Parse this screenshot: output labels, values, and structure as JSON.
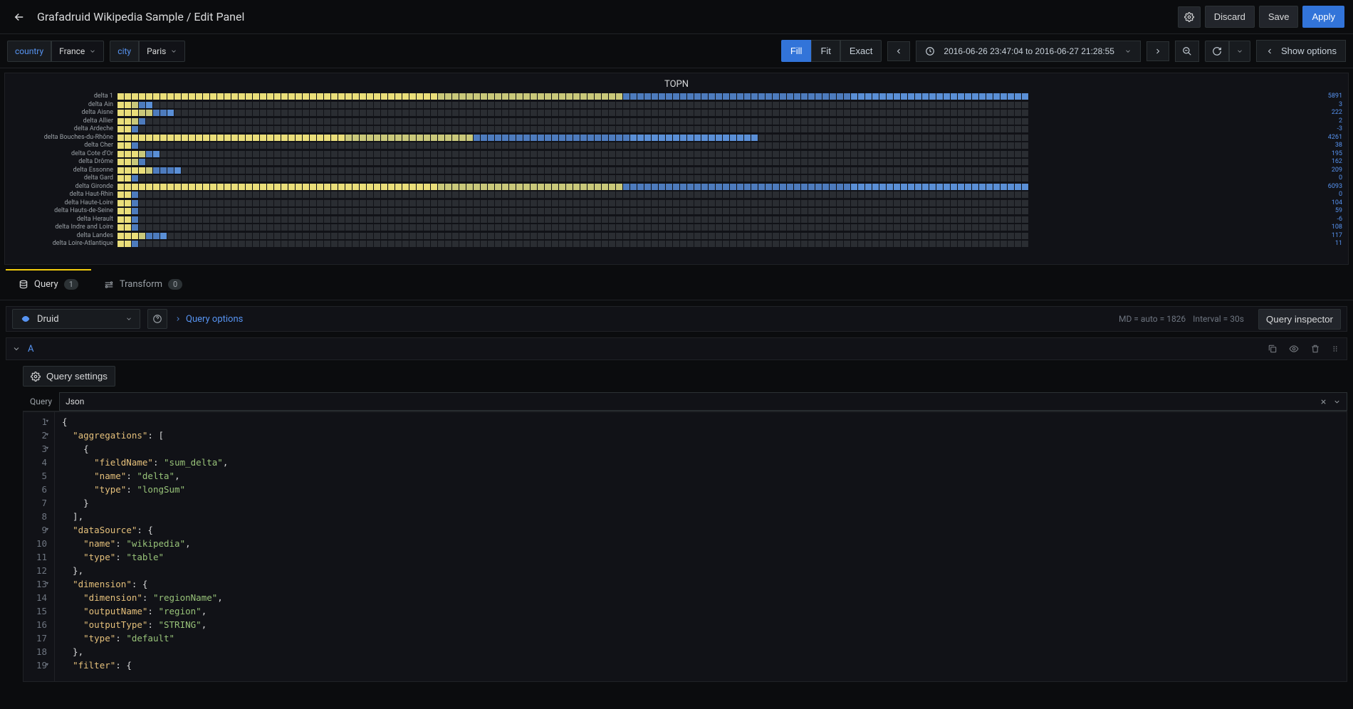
{
  "header": {
    "breadcrumb": "Grafadruid Wikipedia Sample / Edit Panel",
    "discard": "Discard",
    "save": "Save",
    "apply": "Apply"
  },
  "toolbar": {
    "country_label": "country",
    "country_value": "France",
    "city_label": "city",
    "city_value": "Paris",
    "fill": "Fill",
    "fit": "Fit",
    "exact": "Exact",
    "time_range": "2016-06-26 23:47:04 to 2016-06-27 21:28:55",
    "show_options": "Show options"
  },
  "viz": {
    "title": "TOPN",
    "series": [
      {
        "label": "delta 1",
        "value": "5891",
        "fill": 128
      },
      {
        "label": "delta Ain",
        "value": "3",
        "fill": 5
      },
      {
        "label": "delta Aisne",
        "value": "222",
        "fill": 8
      },
      {
        "label": "delta Allier",
        "value": "2",
        "fill": 4
      },
      {
        "label": "delta Ardeche",
        "value": "-3",
        "fill": 3
      },
      {
        "label": "delta Bouches-du-Rhône",
        "value": "4261",
        "fill": 90
      },
      {
        "label": "delta Cher",
        "value": "38",
        "fill": 3
      },
      {
        "label": "delta Cote d'Or",
        "value": "195",
        "fill": 6
      },
      {
        "label": "delta Drôme",
        "value": "162",
        "fill": 4
      },
      {
        "label": "delta Essonne",
        "value": "209",
        "fill": 9
      },
      {
        "label": "delta Gard",
        "value": "0",
        "fill": 3
      },
      {
        "label": "delta Gironde",
        "value": "6093",
        "fill": 128
      },
      {
        "label": "delta Haut-Rhin",
        "value": "0",
        "fill": 3
      },
      {
        "label": "delta Haute-Loire",
        "value": "104",
        "fill": 3
      },
      {
        "label": "delta Hauts-de-Seine",
        "value": "59",
        "fill": 3
      },
      {
        "label": "delta Herault",
        "value": "-6",
        "fill": 3
      },
      {
        "label": "delta Indre and Loire",
        "value": "108",
        "fill": 3
      },
      {
        "label": "delta Landes",
        "value": "117",
        "fill": 7
      },
      {
        "label": "delta Loire-Atlantique",
        "value": "11",
        "fill": 3
      }
    ]
  },
  "tabs": {
    "query": "Query",
    "query_count": "1",
    "transform": "Transform",
    "transform_count": "0"
  },
  "qbar": {
    "datasource": "Druid",
    "query_options": "Query options",
    "meta_md": "MD = auto = 1826",
    "meta_interval": "Interval = 30s",
    "inspector": "Query inspector"
  },
  "qrow": {
    "letter": "A"
  },
  "qsettings": {
    "label": "Query settings"
  },
  "editor": {
    "head_label": "Query",
    "head_value": "Json",
    "lines": [
      "{",
      "  \"aggregations\": [",
      "    {",
      "      \"fieldName\": \"sum_delta\",",
      "      \"name\": \"delta\",",
      "      \"type\": \"longSum\"",
      "    }",
      "  ],",
      "  \"dataSource\": {",
      "    \"name\": \"wikipedia\",",
      "    \"type\": \"table\"",
      "  },",
      "  \"dimension\": {",
      "    \"dimension\": \"regionName\",",
      "    \"outputName\": \"region\",",
      "    \"outputType\": \"STRING\",",
      "    \"type\": \"default\"",
      "  },",
      "  \"filter\": {"
    ]
  },
  "chart_data": {
    "type": "bar",
    "title": "TOPN",
    "categories": [
      "delta 1",
      "delta Ain",
      "delta Aisne",
      "delta Allier",
      "delta Ardeche",
      "delta Bouches-du-Rhône",
      "delta Cher",
      "delta Cote d'Or",
      "delta Drôme",
      "delta Essonne",
      "delta Gard",
      "delta Gironde",
      "delta Haut-Rhin",
      "delta Haute-Loire",
      "delta Hauts-de-Seine",
      "delta Herault",
      "delta Indre and Loire",
      "delta Landes",
      "delta Loire-Atlantique"
    ],
    "values": [
      5891,
      3,
      222,
      2,
      -3,
      4261,
      38,
      195,
      162,
      209,
      0,
      6093,
      0,
      104,
      59,
      -6,
      108,
      117,
      11
    ],
    "xlabel": "",
    "ylabel": "",
    "ylim": [
      -10,
      6500
    ]
  }
}
